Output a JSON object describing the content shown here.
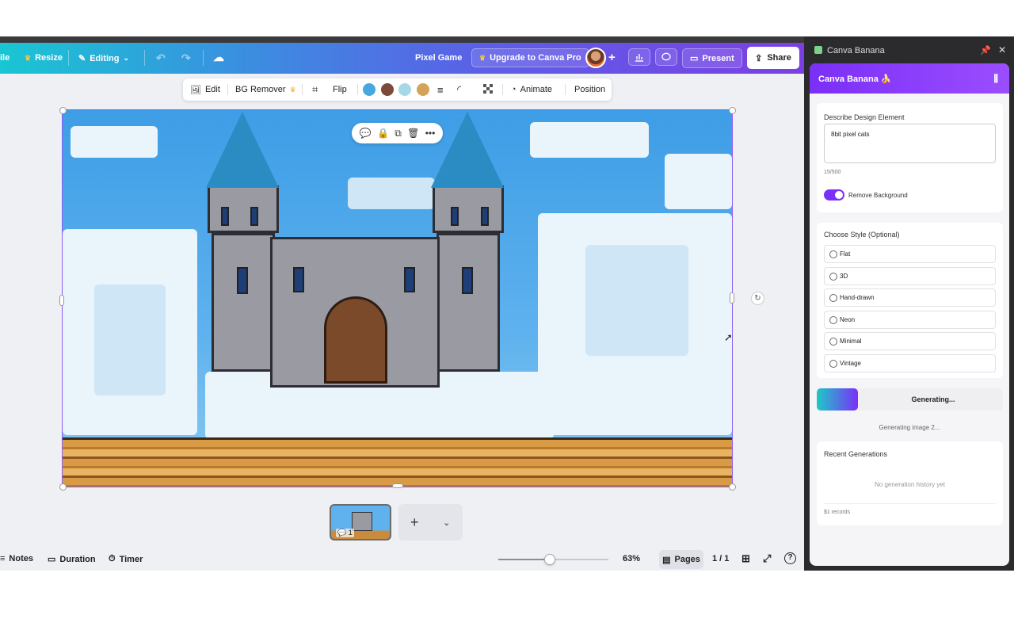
{
  "topbar": {
    "file_label": "ile",
    "resize_label": "Resize",
    "editing_label": "Editing",
    "doc_title": "Pixel Game",
    "upgrade_label": "Upgrade to Canva Pro",
    "present_label": "Present",
    "share_label": "Share"
  },
  "context_toolbar": {
    "edit_label": "Edit",
    "bg_remover_label": "BG Remover",
    "flip_label": "Flip",
    "animate_label": "Animate",
    "position_label": "Position",
    "swatches": [
      "#4aa6de",
      "#7a4a3a",
      "#a7d8e8",
      "#d4a35a"
    ]
  },
  "footer": {
    "notes_label": "Notes",
    "duration_label": "Duration",
    "timer_label": "Timer",
    "zoom_label": "63%",
    "zoom_fraction": 0.47,
    "pages_label": "Pages",
    "page_count": "1 / 1"
  },
  "thumbnail": {
    "comment_count": "1"
  },
  "panel": {
    "window_title": "Canva Banana",
    "header_title": "Canva Banana 🍌",
    "describe_label": "Describe Design Element",
    "describe_value": "8bit pixel cats",
    "char_count": "15/500",
    "remove_bg_label": "Remove Background",
    "style_label": "Choose Style (Optional)",
    "styles": [
      "Flat",
      "3D",
      "Hand-drawn",
      "Neon",
      "Minimal",
      "Vintage"
    ],
    "generating_label": "Generating...",
    "generating_status": "Generating image 2...",
    "recent_label": "Recent Generations",
    "empty_history": "No generation history yet",
    "records": "$1 records"
  },
  "colors": {
    "accent": "#7b2ff7",
    "topbar_start": "#19c6d3",
    "topbar_end": "#7b3fe4"
  }
}
